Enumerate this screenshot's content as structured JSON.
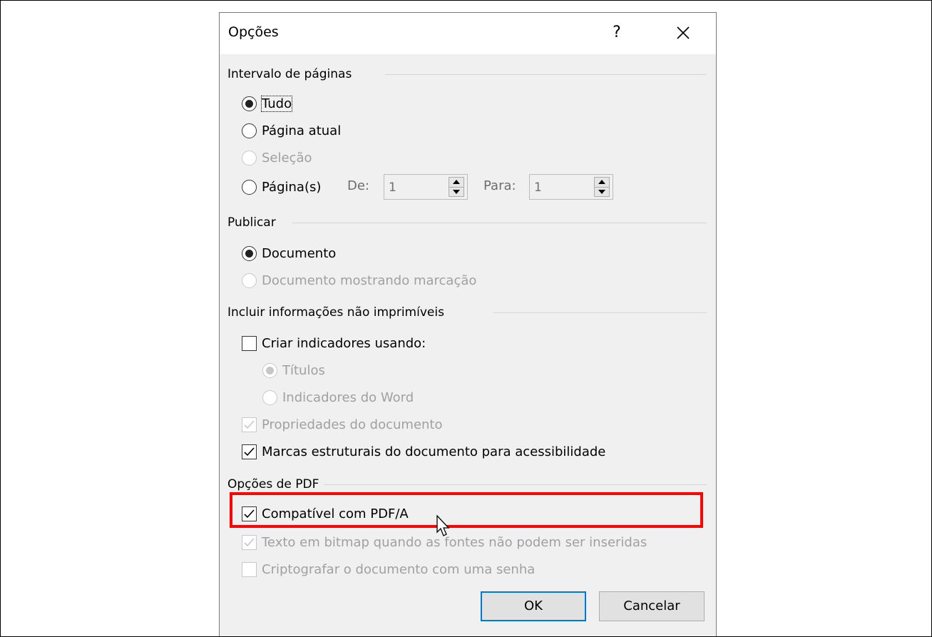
{
  "dialog": {
    "title": "Opções",
    "help_label": "?",
    "close_icon": "close-icon"
  },
  "page_range": {
    "header": "Intervalo de páginas",
    "all_label": "Tudo",
    "current_page_label": "Página atual",
    "selection_label": "Seleção",
    "pages_label": "Página(s)",
    "from_label": "De:",
    "from_value": "1",
    "to_label": "Para:",
    "to_value": "1",
    "selected": "Tudo"
  },
  "publish": {
    "header": "Publicar",
    "document_label": "Documento",
    "document_markup_label": "Documento mostrando marcação",
    "selected": "Documento"
  },
  "non_printing": {
    "header": "Incluir informações não imprimíveis",
    "create_bookmarks_label": "Criar indicadores usando:",
    "create_bookmarks_checked": false,
    "headings_label": "Títulos",
    "word_bookmarks_label": "Indicadores do Word",
    "doc_properties_label": "Propriedades do documento",
    "doc_properties_checked": true,
    "structure_tags_label": "Marcas estruturais do documento para acessibilidade",
    "structure_tags_checked": true
  },
  "pdf_options": {
    "header": "Opções de PDF",
    "pdfa_label": "Compatível com PDF/A",
    "pdfa_checked": true,
    "bitmap_text_label": "Texto em bitmap quando as fontes não podem ser inseridas",
    "bitmap_text_checked": true,
    "encrypt_label": "Criptografar o documento com uma senha",
    "encrypt_checked": false
  },
  "buttons": {
    "ok_label": "OK",
    "cancel_label": "Cancelar"
  },
  "colors": {
    "highlight": "#ff0000",
    "primary_button_border": "#0078d7",
    "dialog_background": "#f0f0f0"
  }
}
